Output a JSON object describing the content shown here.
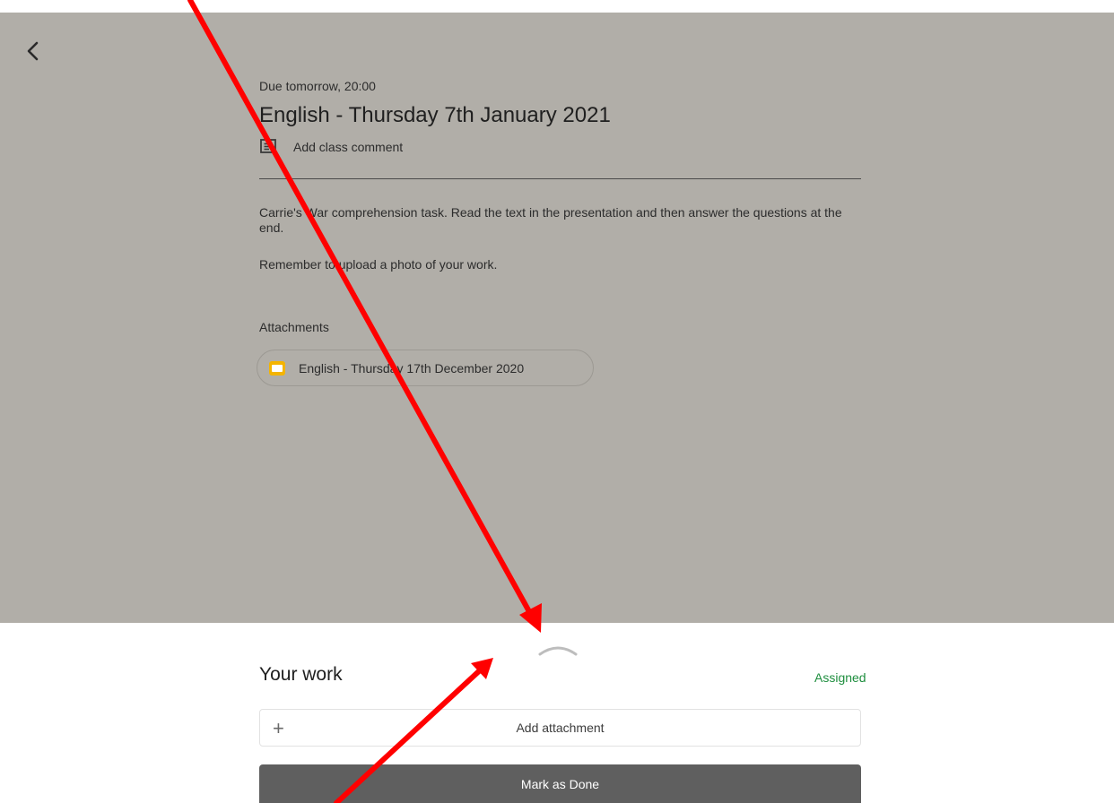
{
  "assignment": {
    "due": "Due tomorrow, 20:00",
    "title": "English - Thursday 7th January 2021",
    "add_comment_label": "Add class comment",
    "description_line1": "Carrie's War comprehension task. Read the text in the presentation and then answer the questions at the end.",
    "description_line2": "Remember to upload a photo of your work.",
    "attachments_label": "Attachments",
    "attachment_chip": {
      "label": "English - Thursday 17th December 2020",
      "icon": "slides-icon",
      "color": "#f4b400"
    }
  },
  "your_work": {
    "heading": "Your work",
    "status": "Assigned",
    "status_color": "#1e8e3e",
    "add_attachment_icon": "+",
    "add_attachment_label": "Add attachment",
    "mark_done_label": "Mark as Done"
  },
  "icons": {
    "back": "chevron-left-icon",
    "comment": "comment-icon",
    "handle": "chevron-up-icon"
  },
  "annotations": {
    "arrow_color": "#ff0000"
  }
}
